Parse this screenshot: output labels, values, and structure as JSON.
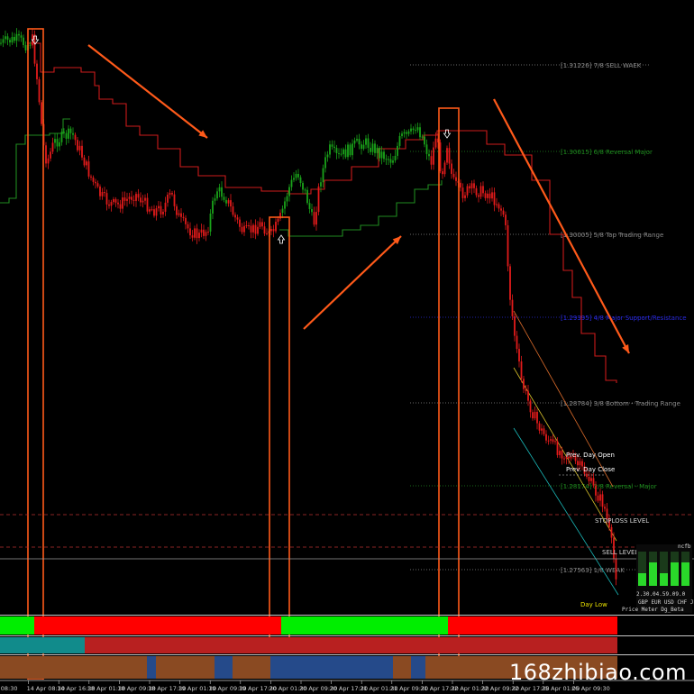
{
  "watermark": "168zhibiao.com",
  "colors": {
    "bull": "#1aa31a",
    "bear": "#e21b1b",
    "resistance": "#cc1b1b",
    "support": "#1f8a1f",
    "annotation": "#ff5a1a",
    "bar_green": "#00ee00",
    "bar_red": "#ff0000",
    "bar_teal": "#118b8b",
    "bar_darkred": "#b82020",
    "bar_brown": "#8a4a22",
    "bar_blue": "#254a8a"
  },
  "chart_data": {
    "type": "candlestick",
    "x_tick_labels": [
      "r 08:30",
      "14 Apr 08:30",
      "14 Apr 16:30",
      "18 Apr 01:30",
      "18 Apr 09:30",
      "18 Apr 17:30",
      "19 Apr 01:30",
      "19 Apr 09:30",
      "19 Apr 17:30",
      "20 Apr 01:30",
      "20 Apr 09:30",
      "20 Apr 17:30",
      "21 Apr 01:30",
      "21 Apr 09:30",
      "21 Apr 17:30",
      "22 Apr 01:30",
      "22 Apr 09:30",
      "22 Apr 17:30",
      "25 Apr 01:00",
      "25 Apr 09:30"
    ],
    "murrey_levels": [
      {
        "label": "[1.31226] 7/8 SELL WAEK",
        "color": "#8a8a8a"
      },
      {
        "label": "[1.30615] 6/8 Reversal Major",
        "color": "#1f8a1f"
      },
      {
        "label": "[1.30005] 5/8 Top Trading Range",
        "color": "#8a8a8a"
      },
      {
        "label": "[1.29395] 4/8 Major Support/Resistance",
        "color": "#2a2ae0"
      },
      {
        "label": "[1.28784] 3/8 Bottom - Trading Range",
        "color": "#8a8a8a"
      },
      {
        "label": "[1.28174] 2/8 Reversal - Major",
        "color": "#1f8a1f"
      },
      {
        "label": "[1.27563] 1/8 WEAK",
        "color": "#8a8a8a"
      }
    ],
    "annotations": {
      "prev_day_open": "Prev. Day Open",
      "prev_day_close": "Prev. Day Close",
      "stop_loss": "STOPLOSS LEVEL",
      "sell_level": "SELL LEVEL",
      "day_low": "Day Low"
    },
    "signals": [
      "sell",
      "buy",
      "sell"
    ],
    "strength_meter": {
      "header": "ncfb",
      "values_text": "2.30.04.59.09.0",
      "currencies": "GBP EUR USD CHF JPY",
      "caption": "Price Meter Dg_Beta"
    }
  }
}
